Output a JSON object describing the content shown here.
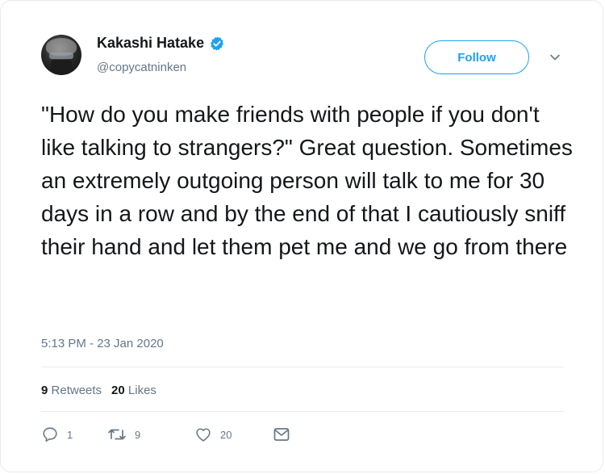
{
  "author": {
    "display_name": "Kakashi Hatake",
    "handle": "@copycatninken",
    "verified": true
  },
  "follow_label": "Follow",
  "tweet": {
    "text": "\"How do you make friends with people if you don't like talking to strangers?\" Great question. Sometimes an extremely outgoing person will talk to me for 30 days in a row and by the end of that I cautiously sniff their hand and let them pet me and we go from there",
    "timestamp": "5:13 PM - 23 Jan 2020"
  },
  "stats": {
    "retweets_count": "9",
    "retweets_label": "Retweets",
    "likes_count": "20",
    "likes_label": "Likes"
  },
  "actions": {
    "reply_count": "1",
    "retweet_count": "9",
    "like_count": "20"
  },
  "icons": [
    "verified-badge-icon",
    "chevron-down-icon",
    "reply-icon",
    "retweet-icon",
    "heart-icon",
    "message-icon"
  ],
  "colors": {
    "accent": "#1da1f2",
    "text_primary": "#14171a",
    "text_secondary": "#657786",
    "border": "#e6ecf0"
  }
}
